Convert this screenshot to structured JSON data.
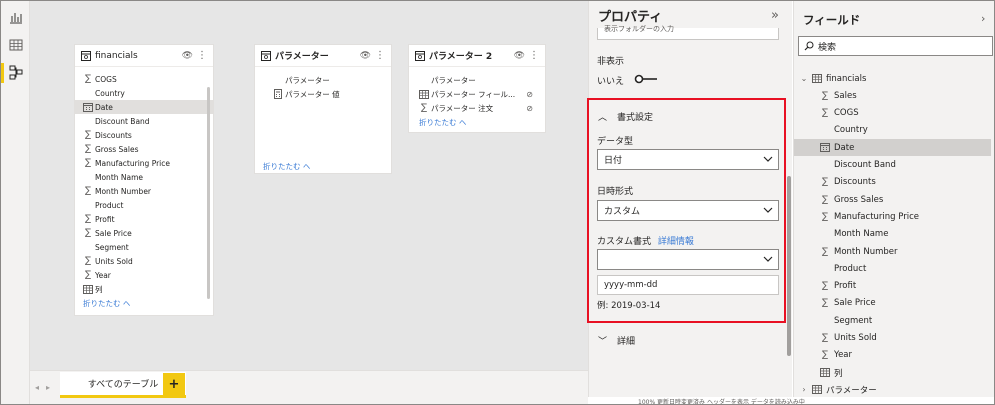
{
  "rail": {
    "icons": [
      "report-icon",
      "data-icon",
      "model-icon"
    ]
  },
  "cards": [
    {
      "title": "financials",
      "fields": [
        {
          "icon": "sigma",
          "label": "COGS"
        },
        {
          "icon": "none",
          "label": "Country"
        },
        {
          "icon": "calendar",
          "label": "Date",
          "selected": true
        },
        {
          "icon": "none",
          "label": "Discount Band"
        },
        {
          "icon": "sigma",
          "label": "Discounts"
        },
        {
          "icon": "sigma",
          "label": "Gross Sales"
        },
        {
          "icon": "sigma",
          "label": "Manufacturing Price"
        },
        {
          "icon": "none",
          "label": "Month Name"
        },
        {
          "icon": "sigma",
          "label": "Month Number"
        },
        {
          "icon": "none",
          "label": "Product"
        },
        {
          "icon": "sigma",
          "label": "Profit"
        },
        {
          "icon": "sigma",
          "label": "Sale Price"
        },
        {
          "icon": "none",
          "label": "Segment"
        },
        {
          "icon": "sigma",
          "label": "Units Sold"
        },
        {
          "icon": "sigma",
          "label": "Year"
        },
        {
          "icon": "table",
          "label": "列"
        }
      ],
      "collapse": "折りたたむ ヘ"
    },
    {
      "title": "パラメーター",
      "fields": [
        {
          "icon": "none",
          "label": "パラメーター"
        },
        {
          "icon": "calc",
          "label": "パラメーター 値"
        }
      ],
      "collapse": "折りたたむ ヘ"
    },
    {
      "title": "パラメーター 2",
      "fields": [
        {
          "icon": "none",
          "label": "パラメーター"
        },
        {
          "icon": "table",
          "label": "パラメーター フィール..."
        },
        {
          "icon": "sigma",
          "label": "パラメーター 注文"
        }
      ],
      "collapse": "折りたたむ ヘ"
    }
  ],
  "tabs": {
    "all_tables": "すべてのテーブル",
    "add": "+"
  },
  "properties": {
    "title": "プロパティ",
    "cut_text": "表示フォルダーの入力",
    "hidden_label": "非表示",
    "hidden_value": "いいえ",
    "format_section": "書式設定",
    "data_type_label": "データ型",
    "data_type_value": "日付",
    "datetime_format_label": "日時形式",
    "datetime_format_value": "カスタム",
    "custom_format_label": "カスタム書式",
    "custom_format_link": "詳細情報",
    "custom_format_value": "yyyy-mm-dd",
    "example": "例: 2019-03-14",
    "advanced_section": "詳細"
  },
  "fields_pane": {
    "title": "フィールド",
    "search_placeholder": "検索",
    "tree": [
      {
        "level": 0,
        "twisty": "v",
        "icon": "table",
        "label": "financials"
      },
      {
        "level": 1,
        "icon": "sigma",
        "label": "Sales"
      },
      {
        "level": 1,
        "icon": "sigma",
        "label": "COGS"
      },
      {
        "level": 1,
        "icon": "none",
        "label": "Country"
      },
      {
        "level": 1,
        "icon": "calendar",
        "label": "Date",
        "selected": true
      },
      {
        "level": 1,
        "icon": "none",
        "label": "Discount Band"
      },
      {
        "level": 1,
        "icon": "sigma",
        "label": "Discounts"
      },
      {
        "level": 1,
        "icon": "sigma",
        "label": "Gross Sales"
      },
      {
        "level": 1,
        "icon": "sigma",
        "label": "Manufacturing Price"
      },
      {
        "level": 1,
        "icon": "none",
        "label": "Month Name"
      },
      {
        "level": 1,
        "icon": "sigma",
        "label": "Month Number"
      },
      {
        "level": 1,
        "icon": "none",
        "label": "Product"
      },
      {
        "level": 1,
        "icon": "sigma",
        "label": "Profit"
      },
      {
        "level": 1,
        "icon": "sigma",
        "label": "Sale Price"
      },
      {
        "level": 1,
        "icon": "none",
        "label": "Segment"
      },
      {
        "level": 1,
        "icon": "sigma",
        "label": "Units Sold"
      },
      {
        "level": 1,
        "icon": "sigma",
        "label": "Year"
      },
      {
        "level": 1,
        "icon": "table",
        "label": "列"
      },
      {
        "level": 0,
        "twisty": ">",
        "icon": "table",
        "label": "パラメーター"
      }
    ]
  },
  "status_strip": "100%   更新日時変更済み   ヘッダーを表示   データを読み込み中"
}
